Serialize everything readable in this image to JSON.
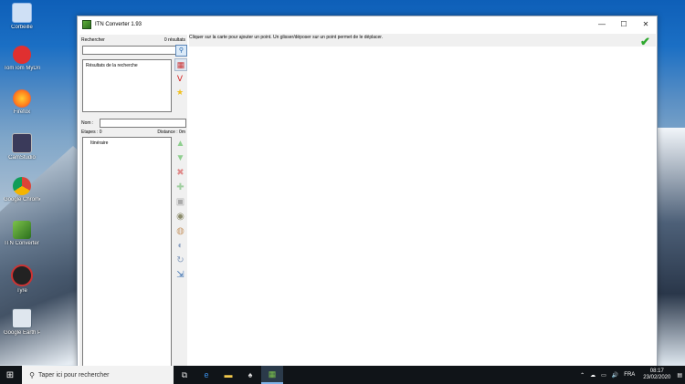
{
  "desktop": {
    "icons": [
      {
        "label": "Corbeille",
        "color": "#8fb6e6"
      },
      {
        "label": "TomTom MyDrive Connect",
        "color": "#e03030"
      },
      {
        "label": "Firefox",
        "color": "#ff7a1a"
      },
      {
        "label": "CamStudio",
        "color": "#3a3a5a"
      },
      {
        "label": "Google Chrome",
        "color": "#e8c43a"
      },
      {
        "label": "ITN Converter",
        "color": "#3c8a2a"
      },
      {
        "label": "Tyre",
        "color": "#2a2a2a"
      },
      {
        "label": "Google Earth Pro",
        "color": "#556677"
      }
    ]
  },
  "window": {
    "title": "ITN Converter 1.93",
    "controls": {
      "minimize": "—",
      "maximize": "☐",
      "close": "✕"
    }
  },
  "search": {
    "label": "Rechercher",
    "count": "0 résultats",
    "value": "",
    "results_header": "Résultats de la recherche"
  },
  "route": {
    "name_label": "Nom :",
    "name_value": "",
    "steps_label": "Etapes : 0",
    "distance_label": "Distance : 0m",
    "itinerary_label": "Itinéraire"
  },
  "map": {
    "hint": "Cliquer sur la carte pour ajouter un point. Un glisser/déposer sur un point permet de le déplacer."
  },
  "taskbar": {
    "search_placeholder": "Taper ici pour rechercher",
    "language": "FRA",
    "time": "08:17",
    "date": "23/02/2020"
  }
}
